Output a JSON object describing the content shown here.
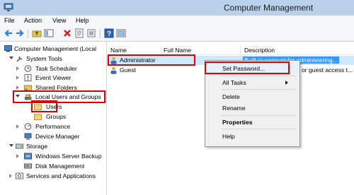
{
  "window": {
    "title": "Computer Management",
    "app_icon": "computer-management-icon"
  },
  "menu": [
    "File",
    "Action",
    "View",
    "Help"
  ],
  "toolbar": {
    "icons": [
      "back-arrow-icon",
      "forward-arrow-icon",
      "up-folder-icon",
      "show-hide-tree-icon",
      "delete-icon",
      "properties-icon",
      "export-list-icon",
      "help-icon",
      "show-pane-icon"
    ]
  },
  "tree": {
    "root": "Computer Management (Local",
    "system_tools": "System Tools",
    "task_scheduler": "Task Scheduler",
    "event_viewer": "Event Viewer",
    "shared_folders": "Shared Folders",
    "local_users_groups": "Local Users and Groups",
    "users": "Users",
    "groups": "Groups",
    "performance": "Performance",
    "device_manager": "Device Manager",
    "storage": "Storage",
    "windows_server_backup": "Windows Server Backup",
    "disk_management": "Disk Management",
    "services_apps": "Services and Applications"
  },
  "list": {
    "headers": {
      "name": "Name",
      "full_name": "Full Name",
      "description": "Description"
    },
    "rows": [
      {
        "name": "Administrator",
        "full_name": "",
        "description": "Built-in account for administering..."
      },
      {
        "name": "Guest",
        "full_name": "",
        "description": "Built-in account for guest access t..."
      }
    ],
    "row2_visible_desc": "or guest access t..."
  },
  "context_menu": {
    "set_password": "Set Password...",
    "all_tasks": "All Tasks",
    "delete": "Delete",
    "rename": "Rename",
    "properties": "Properties",
    "help": "Help"
  },
  "colors": {
    "highlight": "#e00000",
    "selection": "#cde8ff",
    "titlebar": "#b9d1ea"
  }
}
